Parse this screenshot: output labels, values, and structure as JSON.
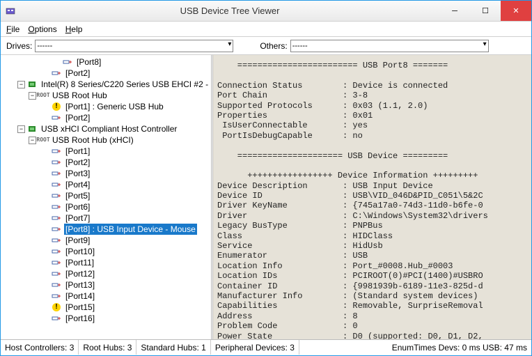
{
  "window": {
    "title": "USB Device Tree Viewer"
  },
  "menu": {
    "file": "File",
    "options": "Options",
    "help": "Help"
  },
  "toolbar": {
    "drives_label": "Drives:",
    "drives_value": "------",
    "others_label": "Others:",
    "others_value": "------"
  },
  "tree": {
    "port8_top": "[Port8]",
    "port2_top": "[Port2]",
    "ehci2": "Intel(R) 8 Series/C220 Series USB EHCI #2 -",
    "usb_root_hub": "USB Root Hub",
    "port1_generic": "[Port1] : Generic USB Hub",
    "port2_mid": "[Port2]",
    "xhci_ctrl": "USB xHCI Compliant Host Controller",
    "usb_root_hub_xhci": "USB Root Hub (xHCI)",
    "p1": "[Port1]",
    "p2": "[Port2]",
    "p3": "[Port3]",
    "p4": "[Port4]",
    "p5": "[Port5]",
    "p6": "[Port6]",
    "p7": "[Port7]",
    "p8_sel": "[Port8] : USB Input Device - Mouse",
    "p9": "[Port9]",
    "p10": "[Port10]",
    "p11": "[Port11]",
    "p12": "[Port12]",
    "p13": "[Port13]",
    "p14": "[Port14]",
    "p15": "[Port15]",
    "p16": "[Port16]"
  },
  "detail_text": "    ======================== USB Port8 =======\n\nConnection Status        : Device is connected\nPort Chain               : 3-8\nSupported Protocols      : 0x03 (1.1, 2.0)\nProperties               : 0x01\n IsUserConnectable       : yes\n PortIsDebugCapable      : no\n\n    ===================== USB Device =========\n\n      +++++++++++++++++ Device Information +++++++++\nDevice Description       : USB Input Device\nDevice ID                : USB\\VID_046D&PID_C051\\5&2C\nDriver KeyName           : {745a17a0-74d3-11d0-b6fe-0\nDriver                   : C:\\Windows\\System32\\drivers\nLegacy BusType           : PNPBus\nClass                    : HIDClass\nService                  : HidUsb\nEnumerator               : USB\nLocation Info            : Port_#0008.Hub_#0003\nLocation IDs             : PCIROOT(0)#PCI(1400)#USBRO\nContainer ID             : {9981939b-6189-11e3-825d-d\nManufacturer Info        : (Standard system devices)\nCapabilities             : Removable, SurpriseRemoval\nAddress                  : 8\nProblem Code             : 0\nPower State              : D0 (supported: D0, D1, D2,",
  "status": {
    "host_ctrls": "Host Controllers: 3",
    "root_hubs": "Root Hubs: 3",
    "std_hubs": "Standard Hubs: 1",
    "periph": "Peripheral Devices: 3",
    "enum": "EnumTimes   Devs: 0 ms   USB: 47 ms"
  }
}
